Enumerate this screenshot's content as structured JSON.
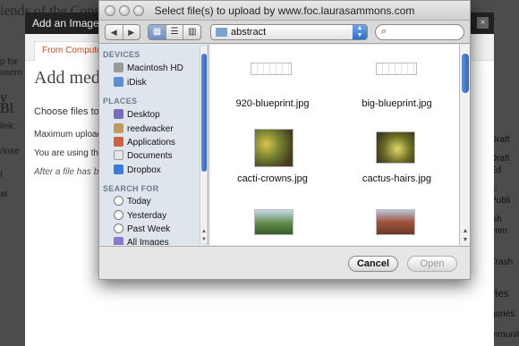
{
  "background": {
    "crumb": "iends of the Conse",
    "left_snips": [
      "p for",
      "usem",
      "v Bl",
      "link:",
      "/Inse",
      "I",
      "at"
    ],
    "right_col": [
      "Draft",
      "Draft Ed",
      "s: Publi",
      "ish imm",
      "Trash",
      "ries",
      "gories",
      "mmunit",
      "nts"
    ]
  },
  "thickbox": {
    "title": "Add an Image",
    "close": "×",
    "tab": "From Computer",
    "heading": "Add media",
    "choose": "Choose files to",
    "max_upload": "Maximum upload",
    "using": "You are using the",
    "after": "After a file has be"
  },
  "dialog": {
    "title": "Select file(s) to upload by www.foc.laurasammons.com",
    "nav": {
      "back": "◀",
      "forward": "▶"
    },
    "view": {
      "icon": "▦",
      "list": "☰",
      "columns": "▥"
    },
    "folder": "abstract",
    "search": {
      "icon": "⌕",
      "placeholder": ""
    },
    "sidebar": {
      "devices_header": "DEVICES",
      "devices": [
        {
          "label": "Macintosh HD",
          "icon": "hard-drive-icon"
        },
        {
          "label": "iDisk",
          "icon": "idisk-icon"
        }
      ],
      "places_header": "PLACES",
      "places": [
        {
          "label": "Desktop",
          "icon": "desktop-icon"
        },
        {
          "label": "reedwacker",
          "icon": "home-icon"
        },
        {
          "label": "Applications",
          "icon": "applications-icon"
        },
        {
          "label": "Documents",
          "icon": "documents-icon"
        },
        {
          "label": "Dropbox",
          "icon": "dropbox-icon"
        }
      ],
      "search_header": "SEARCH FOR",
      "search_for": [
        {
          "label": "Today",
          "icon": "clock-icon"
        },
        {
          "label": "Yesterday",
          "icon": "clock-icon"
        },
        {
          "label": "Past Week",
          "icon": "clock-icon"
        },
        {
          "label": "All Images",
          "icon": "images-icon"
        }
      ]
    },
    "files": [
      {
        "name": "920-blueprint.jpg"
      },
      {
        "name": "big-blueprint.jpg"
      },
      {
        "name": "cacti-crowns.jpg"
      },
      {
        "name": "cactus-hairs.jpg"
      },
      {
        "name": ""
      },
      {
        "name": ""
      }
    ],
    "buttons": {
      "cancel": "Cancel",
      "open": "Open"
    }
  }
}
